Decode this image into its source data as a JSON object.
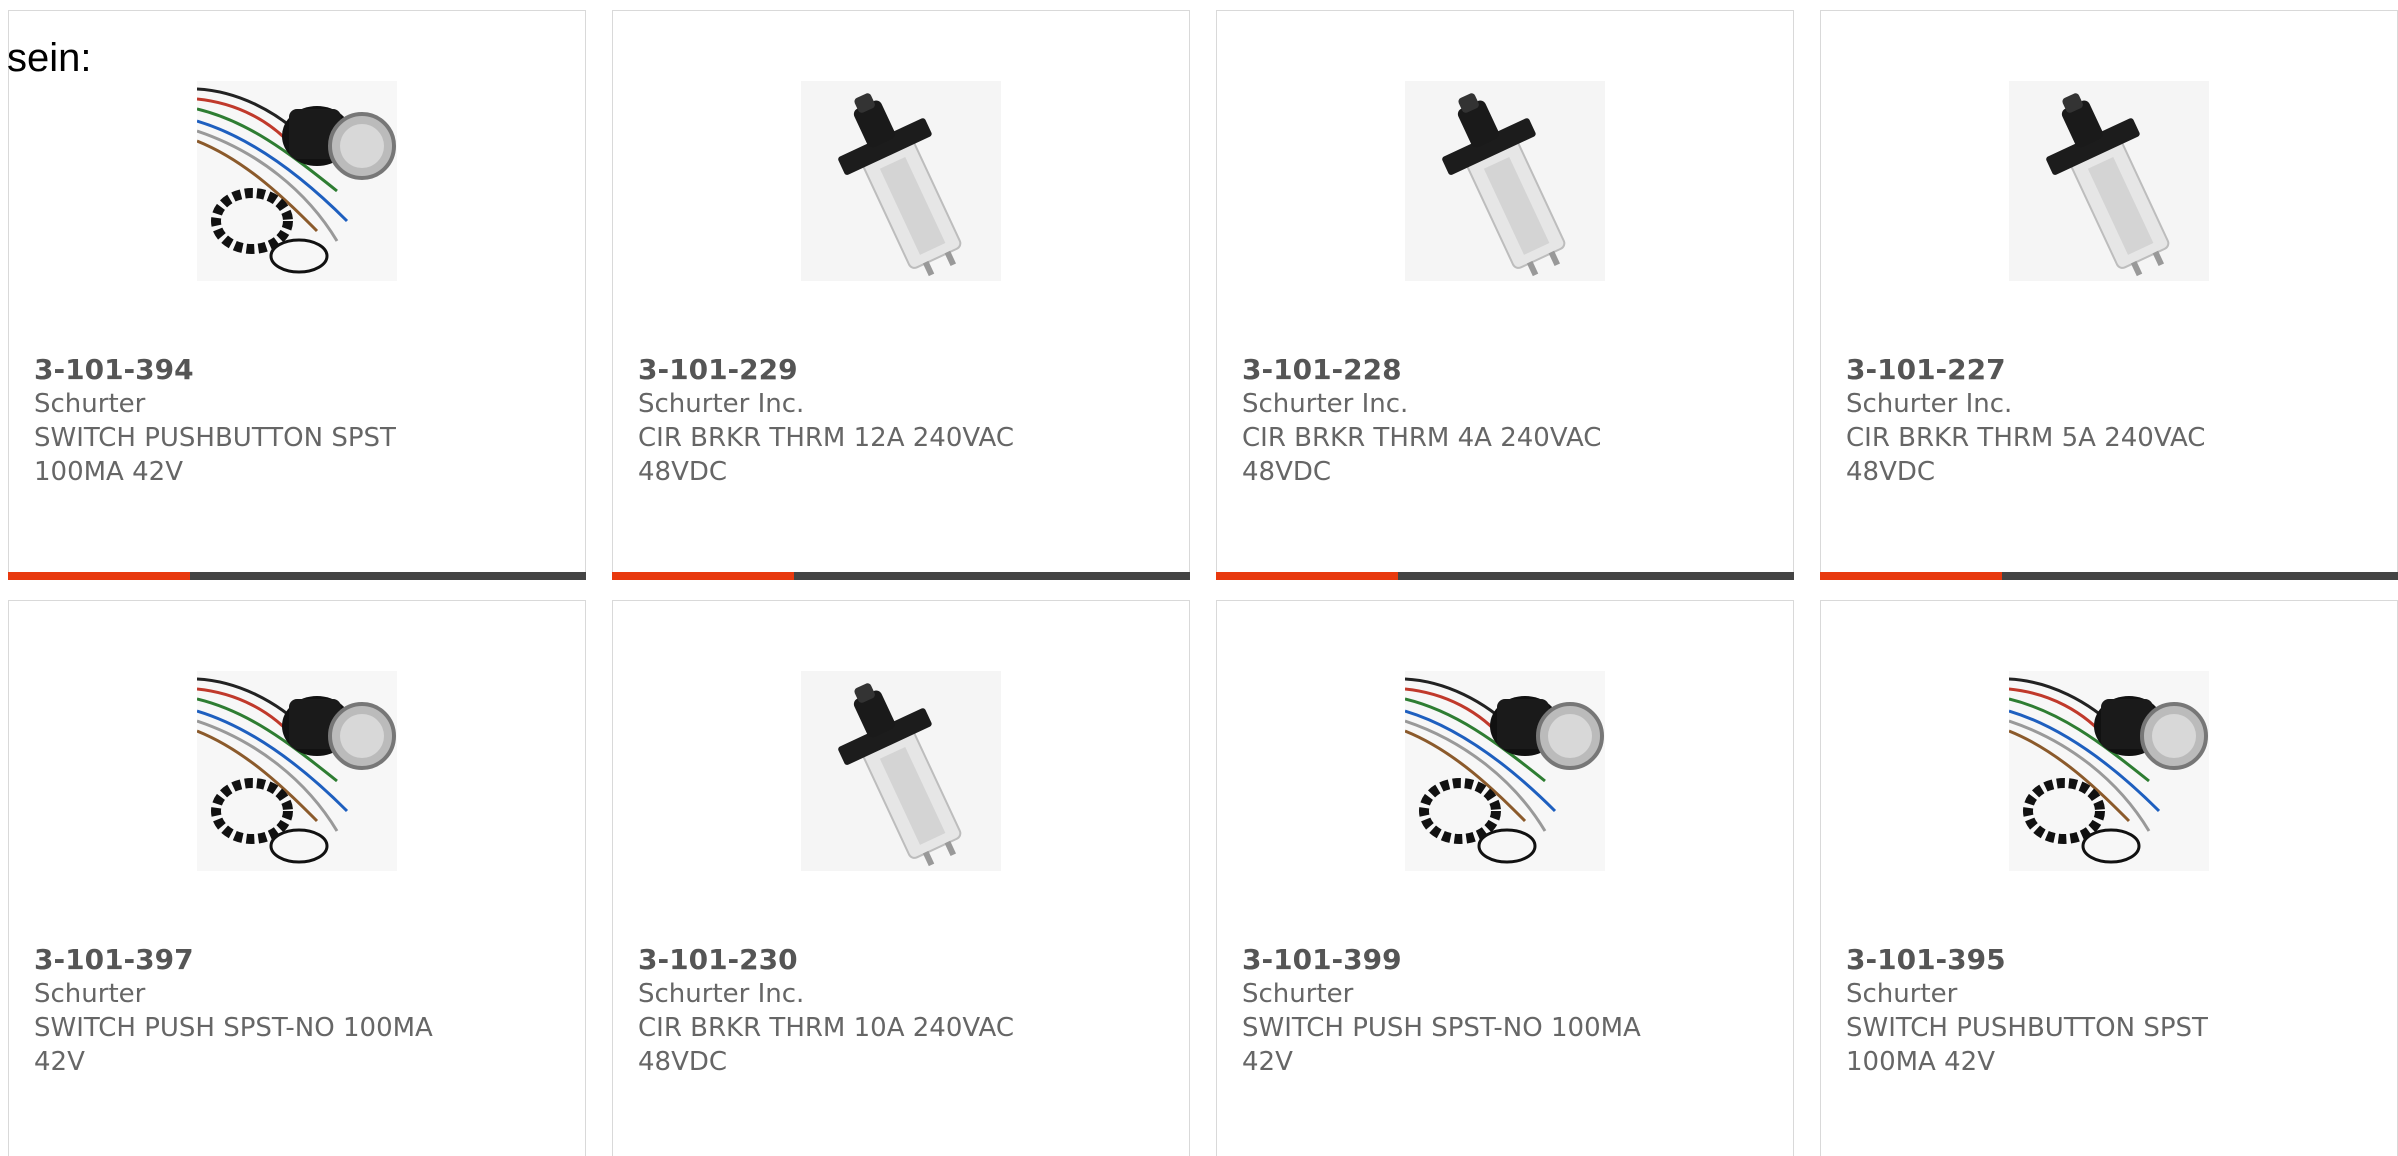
{
  "heading": "sein:",
  "colors": {
    "accent": "#e8390e",
    "bar": "#444444",
    "border": "#d9d9d9",
    "text": "#666666"
  },
  "products": [
    {
      "part_number": "3-101-394",
      "manufacturer": "Schurter",
      "description": "SWITCH PUSHBUTTON SPST 100MA 42V",
      "image_icon": "pushbutton-switch-icon"
    },
    {
      "part_number": "3-101-229",
      "manufacturer": "Schurter Inc.",
      "description": "CIR BRKR THRM 12A 240VAC 48VDC",
      "image_icon": "circuit-breaker-icon"
    },
    {
      "part_number": "3-101-228",
      "manufacturer": "Schurter Inc.",
      "description": "CIR BRKR THRM 4A 240VAC 48VDC",
      "image_icon": "circuit-breaker-icon"
    },
    {
      "part_number": "3-101-227",
      "manufacturer": "Schurter Inc.",
      "description": "CIR BRKR THRM 5A 240VAC 48VDC",
      "image_icon": "circuit-breaker-icon"
    },
    {
      "part_number": "3-101-397",
      "manufacturer": "Schurter",
      "description": "SWITCH PUSH SPST-NO 100MA 42V",
      "image_icon": "pushbutton-switch-icon"
    },
    {
      "part_number": "3-101-230",
      "manufacturer": "Schurter Inc.",
      "description": "CIR BRKR THRM 10A 240VAC 48VDC",
      "image_icon": "circuit-breaker-icon"
    },
    {
      "part_number": "3-101-399",
      "manufacturer": "Schurter",
      "description": "SWITCH PUSH SPST-NO 100MA 42V",
      "image_icon": "pushbutton-switch-icon"
    },
    {
      "part_number": "3-101-395",
      "manufacturer": "Schurter",
      "description": "SWITCH PUSHBUTTON SPST 100MA 42V",
      "image_icon": "pushbutton-switch-icon"
    }
  ]
}
